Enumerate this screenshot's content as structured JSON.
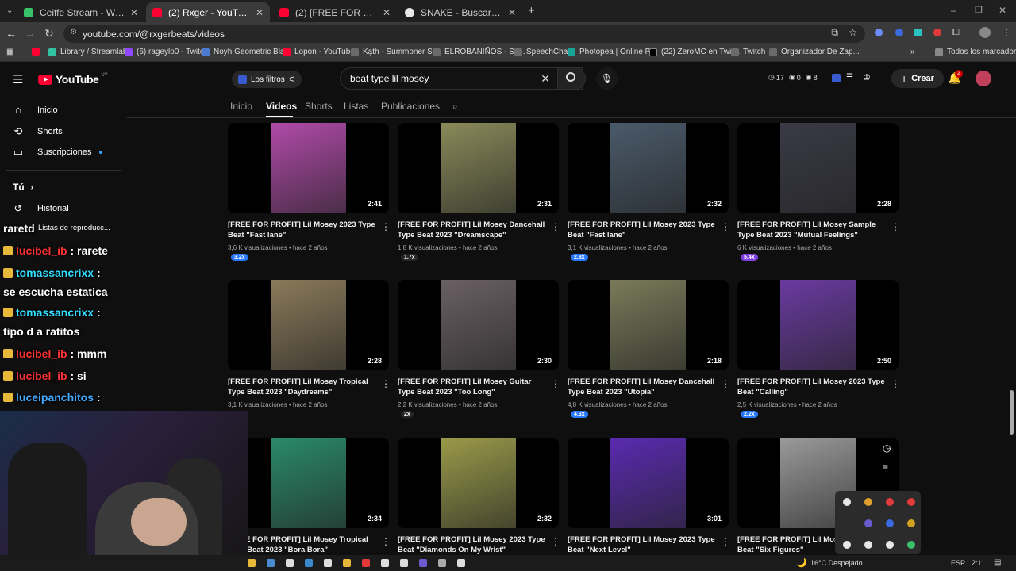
{
  "browser": {
    "tabs": [
      {
        "title": "Ceiffe Stream - Watch Live",
        "color": "#3ac26b"
      },
      {
        "title": "(2) Rxger - YouTube",
        "color": "#ff0033"
      },
      {
        "title": "(2) [FREE FOR PROFIT] Lil Mose",
        "color": "#ff0033"
      },
      {
        "title": "SNAKE - Buscar con Google",
        "color": "#e8e8e8"
      }
    ],
    "new_tab": "+",
    "url": "youtube.com/@rxgerbeats/videos",
    "bookmarks": [
      {
        "label": "",
        "color": "#ff0033"
      },
      {
        "label": "Library / Streamlabs",
        "color": "#31c3a2"
      },
      {
        "label": "(6) rageylo0 - Twitch",
        "color": "#9146ff"
      },
      {
        "label": "Noyh Geometric Bla...",
        "color": "#4a7bd1"
      },
      {
        "label": "Lopon - YouTube",
        "color": "#ff0033"
      },
      {
        "label": "Kạth - Summoner St...",
        "color": "#6a6a6a"
      },
      {
        "label": "ELROBANIÑOS - Su...",
        "color": "#6a6a6a"
      },
      {
        "label": "SpeechChat",
        "color": "#6a6a6a"
      },
      {
        "label": "Photopea | Online P...",
        "color": "#18a497"
      },
      {
        "label": "(22) ZeroMC en Twit...",
        "color": "#000000"
      },
      {
        "label": "Twitch",
        "color": "#6a6a6a"
      },
      {
        "label": "Organizador De Zap...",
        "color": "#6a6a6a"
      }
    ],
    "bookmarks_more": "»",
    "all_bookmarks": "Todos los marcadores"
  },
  "youtube": {
    "logo": "YouTube",
    "region": "UY",
    "filters_label": "Los filtros",
    "search_value": "beat type lil mosey",
    "ext_counts": [
      "17",
      "0",
      "8"
    ],
    "create_label": "Crear",
    "notif_count": "2"
  },
  "channel_tabs": [
    "Inicio",
    "Videos",
    "Shorts",
    "Listas",
    "Publicaciones"
  ],
  "sidebar": {
    "items": [
      "Inicio",
      "Shorts",
      "Suscripciones"
    ],
    "you_label": "Tú",
    "you_items": [
      "Historial",
      "Listas de reproducc..."
    ]
  },
  "videos": [
    {
      "title": "[FREE FOR PROFIT] Lil Mosey 2023 Type Beat \"Fast lane\"",
      "duration": "2:41",
      "views": "3,6 K visualizaciones",
      "age": "hace 2 años",
      "badge": "3.2x",
      "badge_color": "#2979ff",
      "pic": "#b04aa8"
    },
    {
      "title": "[FREE FOR PROFIT] Lil Mosey Dancehall Type Beat 2023 \"Dreamscape\"",
      "duration": "2:31",
      "views": "1,8 K visualizaciones",
      "age": "hace 2 años",
      "badge": "1.7x",
      "badge_color": "#262626",
      "pic": "#8a8a5a"
    },
    {
      "title": "[FREE FOR PROFIT] Lil Mosey 2023 Type Beat \"Fast lane\"",
      "duration": "2:32",
      "views": "3,1 K visualizaciones",
      "age": "hace 2 años",
      "badge": "2.8x",
      "badge_color": "#2979ff",
      "pic": "#4a5a6a"
    },
    {
      "title": "[FREE FOR PROFIT] Lil Mosey Sample Type Beat 2023 \"Mutual Feelings\"",
      "duration": "2:28",
      "views": "6 K visualizaciones",
      "age": "hace 2 años",
      "badge": "5.4x",
      "badge_color": "#7e3fe0",
      "pic": "#3a3a46"
    },
    {
      "title": "[FREE FOR PROFIT] Lil Mosey Tropical Type Beat 2023 \"Daydreams\"",
      "duration": "2:28",
      "views": "3,1 K visualizaciones",
      "age": "hace 2 años",
      "badge": "",
      "badge_color": "#262626",
      "pic": "#8a7a5a"
    },
    {
      "title": "[FREE FOR PROFIT] Lil Mosey Guitar Type Beat 2023 \"Too Long\"",
      "duration": "2:30",
      "views": "2,2 K visualizaciones",
      "age": "hace 2 años",
      "badge": "2x",
      "badge_color": "#262626",
      "pic": "#6a6064"
    },
    {
      "title": "[FREE FOR PROFIT] Lil Mosey Dancehall Type Beat 2023 \"Utopia\"",
      "duration": "2:18",
      "views": "4,8 K visualizaciones",
      "age": "hace 2 años",
      "badge": "4.3x",
      "badge_color": "#2979ff",
      "pic": "#7a7a5a"
    },
    {
      "title": "[FREE FOR PROFIT] Lil Mosey 2023 Type Beat \"Calling\"",
      "duration": "2:50",
      "views": "2,5 K visualizaciones",
      "age": "hace 2 años",
      "badge": "2.2x",
      "badge_color": "#2979ff",
      "pic": "#6a3aa0"
    },
    {
      "title": "[FREE FOR PROFIT] Lil Mosey Tropical Type Beat 2023 \"Bora Bora\"",
      "duration": "2:34",
      "views": "",
      "age": "",
      "badge": "",
      "badge_color": "#262626",
      "pic": "#2a8a6a"
    },
    {
      "title": "[FREE FOR PROFIT] Lil Mosey 2023 Type Beat \"Diamonds On My Wrist\"",
      "duration": "2:32",
      "views": "",
      "age": "",
      "badge": "",
      "badge_color": "#262626",
      "pic": "#9a9a4a"
    },
    {
      "title": "[FREE FOR PROFIT] Lil Mosey 2023 Type Beat \"Next Level\"",
      "duration": "3:01",
      "views": "",
      "age": "",
      "badge": "",
      "badge_color": "#262626",
      "pic": "#5a2ab0"
    },
    {
      "title": "[FREE FOR PROFIT] Lil Mosey 2023 Type Beat \"Six Figures\"",
      "duration": "",
      "views": "",
      "age": "",
      "badge": "",
      "badge_color": "#262626",
      "pic": "#9a9a9a"
    }
  ],
  "chat": [
    {
      "user": "raretd",
      "msg": "",
      "color": "plain"
    },
    {
      "user": "lucibel_ib",
      "msg": ": rarete",
      "color": "red"
    },
    {
      "user": "tomassancrixx",
      "msg": ":",
      "color": "blue"
    },
    {
      "user": "",
      "msg": "se escucha estatica",
      "color": "plain"
    },
    {
      "user": "tomassancrixx",
      "msg": ":",
      "color": "blue"
    },
    {
      "user": "",
      "msg": "tipo d a ratitos",
      "color": "plain"
    },
    {
      "user": "lucibel_ib",
      "msg": ": mmm",
      "color": "red"
    },
    {
      "user": "lucibel_ib",
      "msg": ": si",
      "color": "red"
    },
    {
      "user": "luceipanchitos",
      "msg": ":",
      "color": "blue2"
    }
  ],
  "taskbar": {
    "weather": "16°C  Despejado",
    "lang": "ESP",
    "time": "2:11"
  }
}
